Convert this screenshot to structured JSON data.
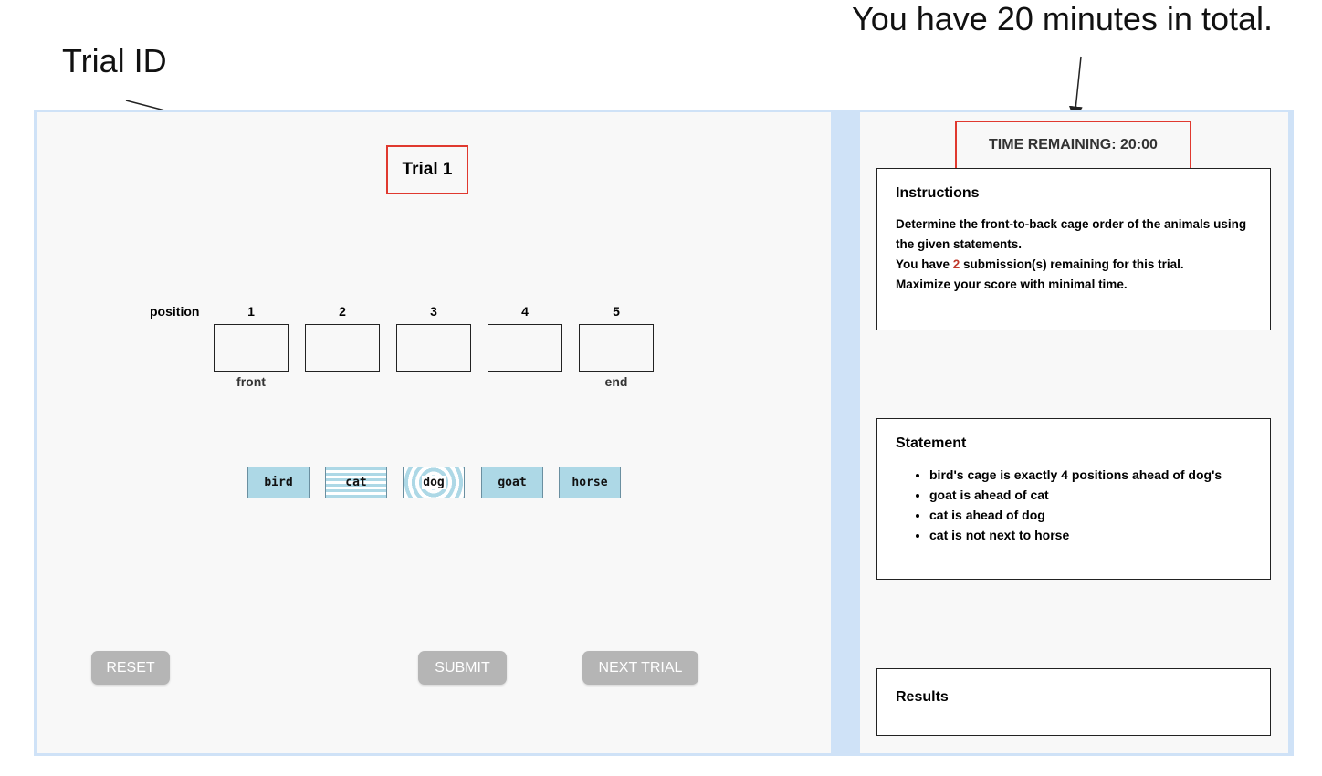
{
  "annotations": {
    "trial_id_label": "Trial ID",
    "time_note": "You have 20 minutes in total."
  },
  "trial": {
    "title": "Trial 1"
  },
  "positions": {
    "row_label": "position",
    "numbers": [
      "1",
      "2",
      "3",
      "4",
      "5"
    ],
    "front_label": "front",
    "end_label": "end"
  },
  "animals": [
    "bird",
    "cat",
    "dog",
    "goat",
    "horse"
  ],
  "buttons": {
    "reset": "RESET",
    "submit": "SUBMIT",
    "next": "NEXT TRIAL"
  },
  "timer": {
    "text": "TIME REMAINING: 20:00"
  },
  "instructions": {
    "heading": "Instructions",
    "line1": "Determine the front-to-back cage order of the animals using the given statements.",
    "line2_prefix": "You have ",
    "remaining": "2",
    "line2_suffix": " submission(s) remaining for this trial.",
    "line3": "Maximize your score with minimal time."
  },
  "statement": {
    "heading": "Statement",
    "items": [
      "bird's cage is exactly 4 positions ahead of dog's",
      "goat is ahead of cat",
      "cat is ahead of dog",
      "cat is not next to horse"
    ]
  },
  "results": {
    "heading": "Results"
  },
  "colors": {
    "highlight_border": "#e0392f",
    "animal_fill": "#add8e6",
    "button_disabled": "#b5b5b5",
    "frame": "#cfe2f7"
  }
}
